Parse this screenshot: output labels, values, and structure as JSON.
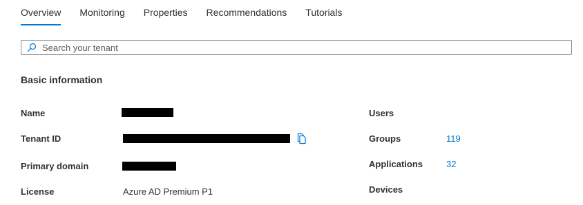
{
  "tabs": [
    {
      "label": "Overview",
      "active": true
    },
    {
      "label": "Monitoring",
      "active": false
    },
    {
      "label": "Properties",
      "active": false
    },
    {
      "label": "Recommendations",
      "active": false
    },
    {
      "label": "Tutorials",
      "active": false
    }
  ],
  "search": {
    "placeholder": "Search your tenant",
    "value": "",
    "icon": "search-icon"
  },
  "basic_info": {
    "title": "Basic information",
    "fields": {
      "name": {
        "label": "Name",
        "value": "[redacted]"
      },
      "tenant_id": {
        "label": "Tenant ID",
        "value": "[redacted]",
        "action_icon": "copy-icon"
      },
      "primary_domain": {
        "label": "Primary domain",
        "value": "[redacted]"
      },
      "license": {
        "label": "License",
        "value": "Azure AD Premium P1"
      }
    },
    "stats": {
      "users": {
        "label": "Users",
        "value": ""
      },
      "groups": {
        "label": "Groups",
        "value": "119"
      },
      "applications": {
        "label": "Applications",
        "value": "32"
      },
      "devices": {
        "label": "Devices",
        "value": ""
      }
    }
  },
  "colors": {
    "accent": "#0078d4",
    "text": "#323130",
    "border": "#8a8886",
    "redaction": "#000000"
  }
}
